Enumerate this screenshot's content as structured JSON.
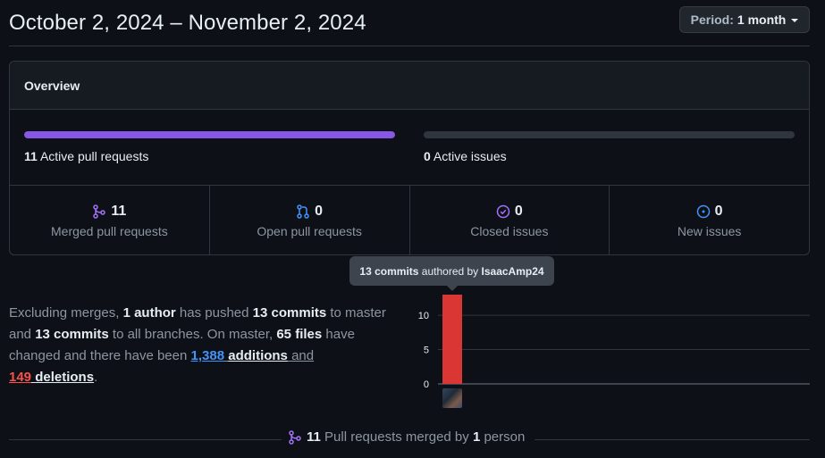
{
  "header": {
    "title": "October 2, 2024 – November 2, 2024",
    "period_label": "Period:",
    "period_value": "1 month"
  },
  "overview": {
    "title": "Overview",
    "active_prs": {
      "count": "11",
      "label": "Active pull requests",
      "fill_fraction": 1.0,
      "color": "#8957e5"
    },
    "active_issues": {
      "count": "0",
      "label": "Active issues",
      "fill_fraction": 0.0,
      "color": "#238636"
    },
    "stats": [
      {
        "icon": "git-merge-icon",
        "count": "11",
        "label": "Merged pull requests",
        "color": "#a371f7"
      },
      {
        "icon": "git-pull-request-icon",
        "count": "0",
        "label": "Open pull requests",
        "color": "#4493f8"
      },
      {
        "icon": "issue-closed-icon",
        "count": "0",
        "label": "Closed issues",
        "color": "#a371f7"
      },
      {
        "icon": "issue-opened-icon",
        "count": "0",
        "label": "New issues",
        "color": "#4493f8"
      }
    ]
  },
  "summary": {
    "p1": "Excluding merges, ",
    "authors": "1 author",
    "p2": " has pushed ",
    "commits_master": "13 commits",
    "p3": " to master and ",
    "commits_all": "13 commits",
    "p4": " to all branches. On master, ",
    "files": "65 files",
    "p5": " have changed and there have been ",
    "additions_num": "1,388",
    "additions_word": "additions",
    "p6": " and",
    "deletions_num": "149",
    "deletions_word": "deletions",
    "p7": "."
  },
  "tooltip": {
    "count": "13 commits",
    "mid": " authored by ",
    "author": "IsaacAmp24"
  },
  "chart_data": {
    "type": "bar",
    "categories": [
      "IsaacAmp24"
    ],
    "values": [
      13
    ],
    "ylim": [
      0,
      13
    ],
    "yticks": [
      0,
      5,
      10
    ],
    "grid": true,
    "bar_color": "#da3633"
  },
  "bottom": {
    "count": "11",
    "text1": " Pull requests merged by ",
    "people": "1",
    "text2": " person"
  }
}
